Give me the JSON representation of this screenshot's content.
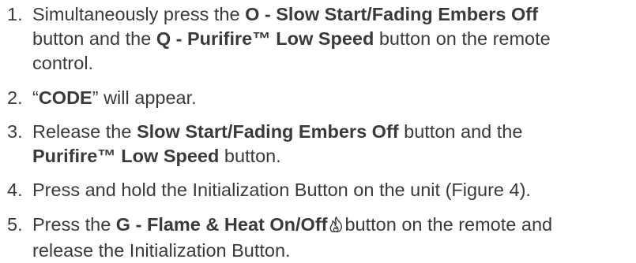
{
  "steps": [
    {
      "number": "1.",
      "lines": [
        {
          "t1": "Simultaneously press the ",
          "b1": "O - Slow Start/Fading Embers Off"
        },
        {
          "t1": "button and the ",
          "b1": "Q - Purifire™ Low Speed",
          "t2": " button on the remote"
        },
        {
          "t1": "control."
        }
      ]
    },
    {
      "number": "2.",
      "lines": [
        {
          "t1": "“",
          "b1": "CODE",
          "t2": "” will appear."
        }
      ]
    },
    {
      "number": "3.",
      "lines": [
        {
          "t1": "Release the ",
          "b1": "Slow Start/Fading Embers Off",
          "t2": " button and the"
        },
        {
          "b1": "Purifire™ Low Speed",
          "t2": " button."
        }
      ]
    },
    {
      "number": "4.",
      "lines": [
        {
          "t1": "Press and hold the Initialization Button on the unit (Figure 4)."
        }
      ]
    },
    {
      "number": "5.",
      "lines": [
        {
          "t1": "Press the ",
          "b1": "G - Flame & Heat On/Off",
          "icon": "flame-icon",
          "t2": "button on the remote and"
        },
        {
          "t1": "release the Initialization Button."
        }
      ]
    }
  ]
}
